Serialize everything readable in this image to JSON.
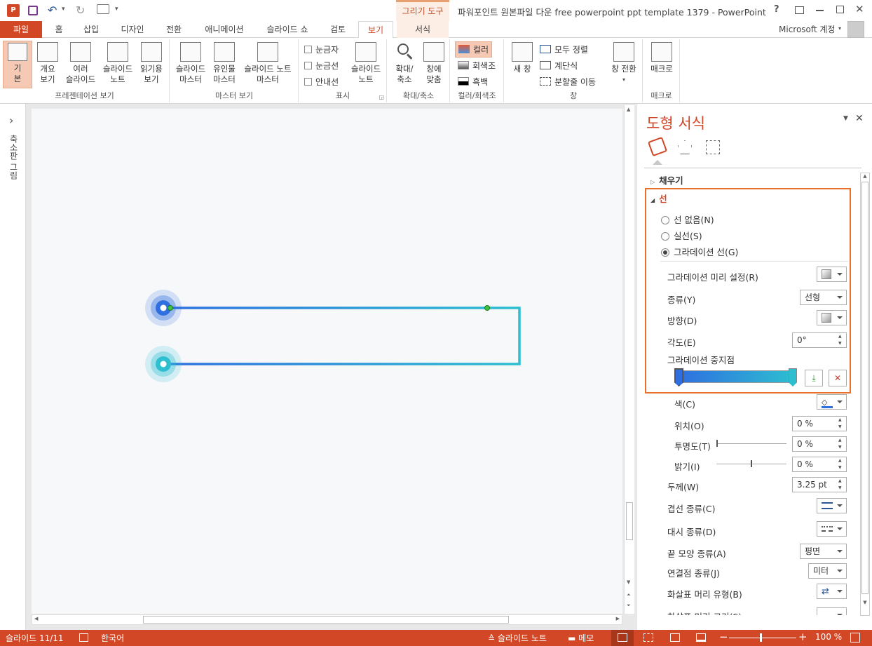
{
  "titlebar": {
    "title": "파워포인트 원본파일 다운 free powerpoint ppt template 1379 - PowerPoint",
    "context_tab": "그리기 도구",
    "help": "?",
    "account": "Microsoft 계정"
  },
  "tabs": [
    "파일",
    "홈",
    "삽입",
    "디자인",
    "전환",
    "애니메이션",
    "슬라이드 쇼",
    "검토",
    "보기",
    "서식"
  ],
  "ribbon": {
    "presentation_views": {
      "label": "프레젠테이션 보기",
      "buttons": [
        "기\n본",
        "개요\n보기",
        "여러\n슬라이드",
        "슬라이드\n노트",
        "읽기용\n보기"
      ]
    },
    "master_views": {
      "label": "마스터 보기",
      "buttons": [
        "슬라이드\n마스터",
        "유인물\n마스터",
        "슬라이드 노트\n마스터"
      ]
    },
    "show": {
      "label": "표시",
      "checks": [
        "눈금자",
        "눈금선",
        "안내선"
      ],
      "notes": "슬라이드\n노트"
    },
    "zoom": {
      "label": "확대/축소",
      "buttons": [
        "확대/\n축소",
        "창에\n맞춤"
      ]
    },
    "color": {
      "label": "컬러/회색조",
      "items": [
        "컬러",
        "회색조",
        "흑백"
      ]
    },
    "window": {
      "label": "창",
      "new_window": "새 창",
      "items": [
        "모두 정렬",
        "계단식",
        "분할줄 이동"
      ],
      "switch": "창 전환"
    },
    "macros": {
      "label": "매크로",
      "button": "매크로"
    }
  },
  "thumbnail_pane": {
    "label": "축소판 그림",
    "toggle": "›"
  },
  "colors": {
    "accent": "#d24726",
    "line_start": "#2f6fe0",
    "line_end": "#2dbfd0"
  },
  "panel": {
    "title": "도형 서식",
    "fill_section": "채우기",
    "line_section": "선",
    "radios": [
      "선 없음(N)",
      "실선(S)",
      "그라데이션 선(G)"
    ],
    "selected_radio": 2,
    "rows": {
      "preset_label": "그라데이션 미리 설정(R)",
      "type_label": "종류(Y)",
      "type_value": "선형",
      "direction_label": "방향(D)",
      "angle_label": "각도(E)",
      "angle_value": "0°",
      "stops_label": "그라데이션 중지점",
      "color_label": "색(C)",
      "position_label": "위치(O)",
      "position_value": "0 %",
      "transparency_label": "투명도(T)",
      "transparency_value": "0 %",
      "brightness_label": "밝기(I)",
      "brightness_value": "0 %",
      "width_label": "두께(W)",
      "width_value": "3.25 pt",
      "compound_label": "겹선 종류(C)",
      "dash_label": "대시 종류(D)",
      "cap_label": "끝 모양 종류(A)",
      "cap_value": "평면",
      "join_label": "연결점 종류(J)",
      "join_value": "미터",
      "arrow_begin_label": "화살표 머리 유형(B)",
      "arrow_size_label": "화살표 머리 크기(S)"
    }
  },
  "status": {
    "slide": "슬라이드 11/11",
    "language": "한국어",
    "notes": "슬라이드 노트",
    "comments": "메모",
    "zoom": "100 %"
  }
}
